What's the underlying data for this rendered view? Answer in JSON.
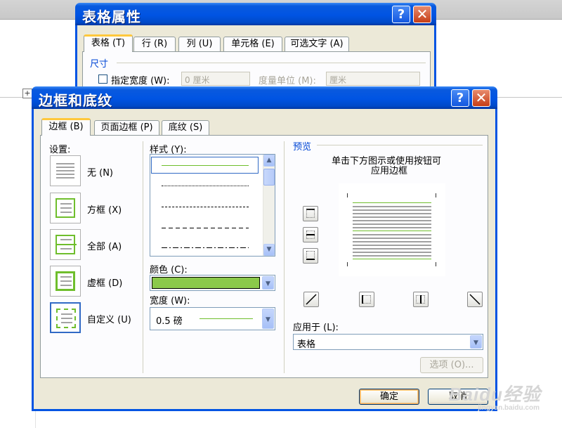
{
  "background_dialog": {
    "title": "表格属性",
    "tabs": [
      {
        "label": "表格 (T)",
        "active": true
      },
      {
        "label": "行 (R)"
      },
      {
        "label": "列 (U)"
      },
      {
        "label": "单元格 (E)"
      },
      {
        "label": "可选文字 (A)"
      }
    ],
    "size_heading": "尺寸",
    "width_checkbox_label": "指定宽度 (W):",
    "width_value": "0 厘米",
    "measure_label": "度量单位 (M):",
    "measure_value": "厘米"
  },
  "dialog": {
    "title": "边框和底纹",
    "help_label": "?",
    "close_label": "✕",
    "tabs": [
      {
        "label": "边框 (B)",
        "active": true
      },
      {
        "label": "页面边框 (P)"
      },
      {
        "label": "底纹 (S)"
      }
    ],
    "settings_label": "设置:",
    "settings": [
      {
        "label": "无 (N)"
      },
      {
        "label": "方框 (X)"
      },
      {
        "label": "全部 (A)"
      },
      {
        "label": "虚框 (D)"
      },
      {
        "label": "自定义 (U)",
        "selected": true
      }
    ],
    "style_label": "样式 (Y):",
    "styles": [
      "solid",
      "dotted",
      "dashed",
      "dashed-wide",
      "dash-dot"
    ],
    "color_label": "颜色 (C):",
    "color_value": "#8bc94a",
    "width_label": "宽度 (W):",
    "width_value": "0.5 磅",
    "preview_label": "预览",
    "preview_hint_line1": "单击下方图示或使用按钮可",
    "preview_hint_line2": "应用边框",
    "apply_label": "应用于 (L):",
    "apply_value": "表格",
    "options_button": "选项 (O)...",
    "ok_button": "确定",
    "cancel_button": "取消"
  },
  "colors": {
    "xp_blue": "#0054e3",
    "dialog_bg": "#ece9d8",
    "border_green": "#6fbe2c",
    "tab_highlight": "#ffc83c"
  },
  "watermark": {
    "text": "Baidu经验",
    "sub": "jingyan.baidu.com"
  }
}
